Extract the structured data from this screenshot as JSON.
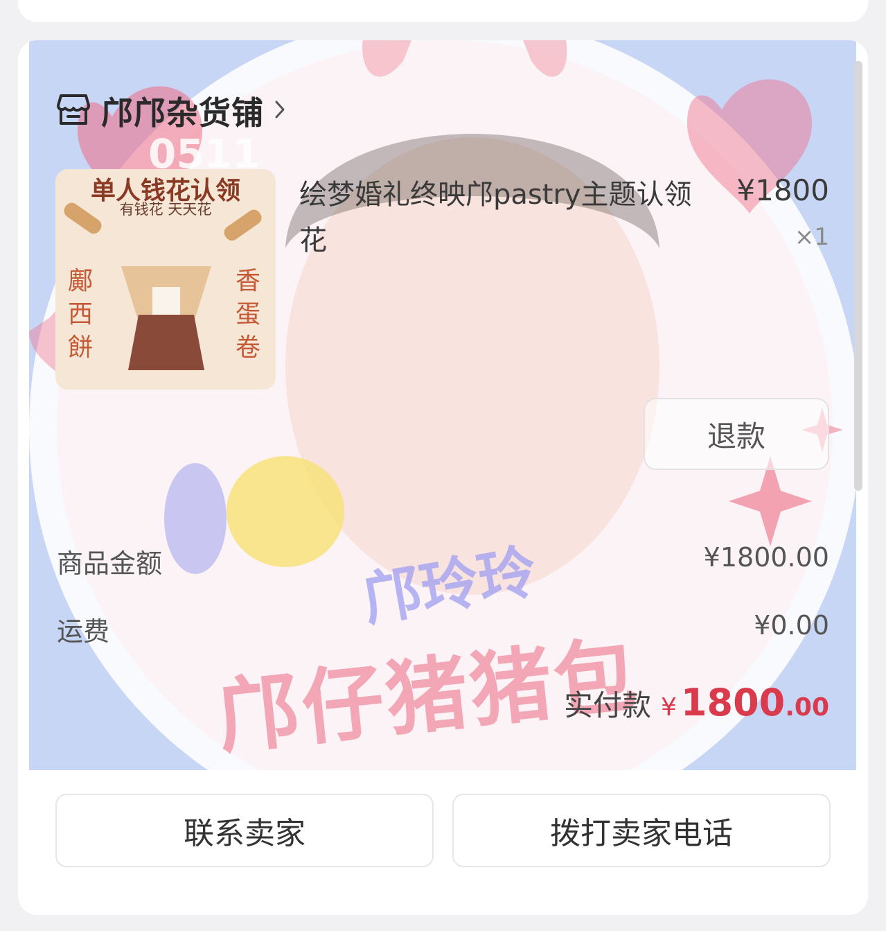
{
  "shop": {
    "name": "邝邝杂货铺",
    "icon": "store-icon"
  },
  "item": {
    "title": "绘梦婚礼终映邝pastry主题认领花",
    "price": "¥1800",
    "qty": "×1",
    "thumb": {
      "head": "单人钱花认领",
      "sub": "有钱花 天天花",
      "left": "鄺西餅",
      "right": "香蛋卷"
    }
  },
  "refund_label": "退款",
  "summary": {
    "goods_label": "商品金额",
    "goods_value": "¥1800.00",
    "shipping_label": "运费",
    "shipping_value": "¥0.00"
  },
  "paid": {
    "label": "实付款",
    "currency": "¥",
    "integer": "1800",
    "decimal": ".00"
  },
  "actions": {
    "contact": "联系卖家",
    "call": "拨打卖家电话"
  },
  "overlay_text": {
    "banner1": "邝玲玲",
    "banner2": "邝仔猪猪包",
    "badge": "0511"
  },
  "colors": {
    "accent": "#d93a4c",
    "bg_blue": "#c8d6f6",
    "heart": "#ef6c84"
  }
}
